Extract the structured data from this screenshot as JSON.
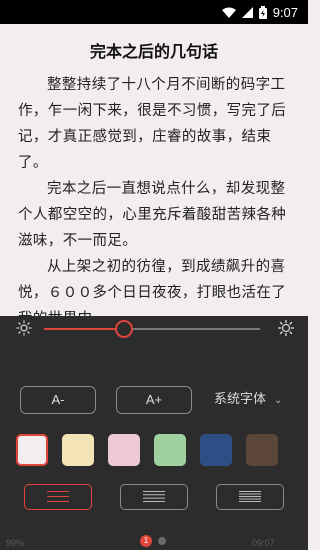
{
  "status_bar": {
    "time": "9:07"
  },
  "reader": {
    "chapter_title": "完本之后的几句话",
    "paragraphs": [
      "整整持续了十八个月不间断的码字工作，乍一闲下来，很是不习惯，写完了后记，才真正感觉到，庄睿的故事，结束了。",
      "完本之后一直想说点什么，却发现整个人都空空的，心里充斥着酸甜苦辣各种滋味，不一而足。",
      "从上架之初的彷徨，到成绩飙升的喜悦，６００多个日日夜夜，打眼也活在了我的世界中。"
    ]
  },
  "settings": {
    "brightness": {
      "level_percent": 37
    },
    "font_decrease_label": "A-",
    "font_increase_label": "A+",
    "typeface_label": "系统字体",
    "background_swatches": [
      {
        "name": "white",
        "color": "#f3eded",
        "selected": true
      },
      {
        "name": "cream",
        "color": "#f4e4b5",
        "selected": false
      },
      {
        "name": "pink",
        "color": "#f0c9d6",
        "selected": false
      },
      {
        "name": "green",
        "color": "#9fd0a0",
        "selected": false
      },
      {
        "name": "blue",
        "color": "#2e4f86",
        "selected": false
      },
      {
        "name": "brown",
        "color": "#5b4639",
        "selected": false
      }
    ],
    "layouts": [
      {
        "name": "loose",
        "selected": true
      },
      {
        "name": "medium",
        "selected": false
      },
      {
        "name": "compact",
        "selected": false
      }
    ],
    "accent_color": "#e0453c"
  },
  "footer": {
    "progress_text": "99%",
    "time_text": "09:07",
    "page_indicator": "1"
  }
}
